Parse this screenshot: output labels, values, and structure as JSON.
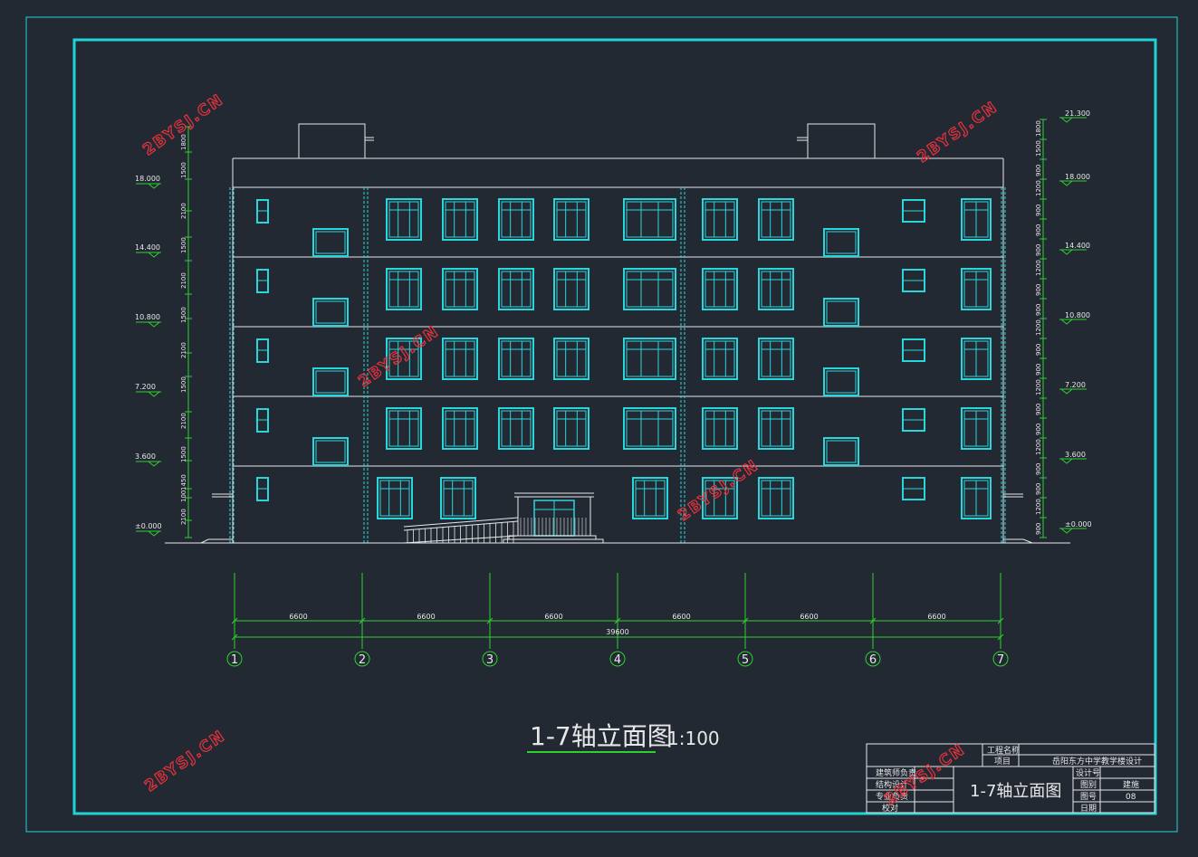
{
  "drawing": {
    "title": "1-7轴立面图",
    "scale": "1:100"
  },
  "elevations_left": [
    {
      "label": "18.000"
    },
    {
      "label": "14.400"
    },
    {
      "label": "10.800"
    },
    {
      "label": "7.200"
    },
    {
      "label": "3.600"
    },
    {
      "label": "±0.000"
    }
  ],
  "elevations_right": [
    {
      "label": "21.300"
    },
    {
      "label": "18.000"
    },
    {
      "label": "14.400"
    },
    {
      "label": "10.800"
    },
    {
      "label": "7.200"
    },
    {
      "label": "3.600"
    },
    {
      "label": "±0.000"
    }
  ],
  "left_dims": [
    "1800",
    "1500",
    "2100",
    "1500",
    "2100",
    "1500",
    "2100",
    "1500",
    "2100",
    "1500",
    "1450",
    "100",
    "2100"
  ],
  "right_dims": [
    "1800",
    "1500",
    "900",
    "1200",
    "900",
    "900",
    "900",
    "1200",
    "900",
    "900",
    "1200",
    "900",
    "900",
    "1200",
    "900",
    "900",
    "1200",
    "900",
    "900",
    "1200",
    "900"
  ],
  "axes": [
    "1",
    "2",
    "3",
    "4",
    "5",
    "6",
    "7"
  ],
  "spans": [
    "6600",
    "6600",
    "6600",
    "6600",
    "6600",
    "6600"
  ],
  "total_span": "39600",
  "title_block": {
    "project_label": "工程名称",
    "item_label": "项目",
    "project_name": "岳阳东方中学教学楼设计",
    "drawing_name": "1-7轴立面图",
    "left_rows": [
      "建筑师负责",
      "结构设计",
      "专业负责",
      "校对"
    ],
    "right_labels": [
      "设计号",
      "图别",
      "图号",
      "日期"
    ],
    "right_values": [
      "",
      "建施",
      "08",
      ""
    ]
  },
  "watermark": "2BYSJ.CN",
  "colors": {
    "background": "#222933",
    "frame": "#1fd3d6",
    "dimension": "#2fd12f",
    "window": "#29d6dc",
    "outline": "#e8e8e8",
    "watermark": "#e8323c"
  }
}
